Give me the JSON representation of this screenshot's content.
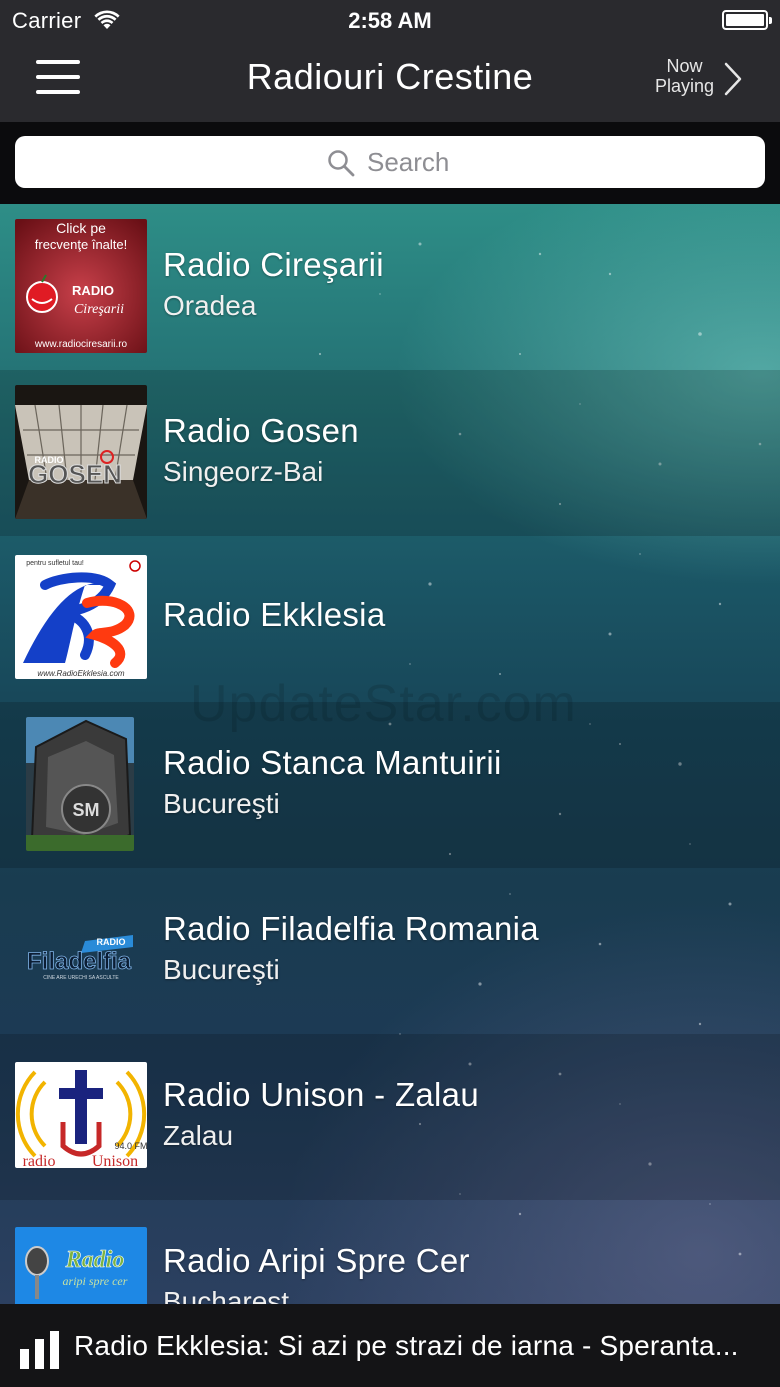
{
  "status_bar": {
    "carrier": "Carrier",
    "time": "2:58 AM"
  },
  "nav": {
    "title": "Radiouri Crestine",
    "now_playing_line1": "Now",
    "now_playing_line2": "Playing"
  },
  "search": {
    "placeholder": "Search"
  },
  "stations": [
    {
      "name": "Radio Cireşarii",
      "city": "Oradea",
      "logo_text": [
        "Click pe",
        "frecvenţe înalte!",
        "RADIO",
        "Cireşarii",
        "www.radiociresarii.ro"
      ]
    },
    {
      "name": "Radio Gosen",
      "city": "Singeorz-Bai",
      "logo_text": [
        "RADIO",
        "GOSEN"
      ]
    },
    {
      "name": "Radio Ekklesia",
      "city": "",
      "logo_text": [
        "pentru sufletul tau!",
        "www.RadioEkklesia.com"
      ]
    },
    {
      "name": "Radio Stanca Mantuirii",
      "city": "Bucureşti",
      "logo_text": [
        "SM"
      ]
    },
    {
      "name": "Radio Filadelfia Romania",
      "city": "Bucureşti",
      "logo_text": [
        "RADIO",
        "Filadelfia",
        "CINE ARE URECHI SA ASCULTE"
      ]
    },
    {
      "name": "Radio Unison - Zalau",
      "city": "Zalau",
      "logo_text": [
        "94.0 FM",
        "radio",
        "Unison"
      ]
    },
    {
      "name": "Radio Aripi Spre Cer",
      "city": "Bucharest",
      "logo_text": [
        "Radio",
        "aripi spre cer"
      ]
    }
  ],
  "watermark": "UpdateStar.com",
  "player": {
    "now_playing": "Radio Ekklesia: Si azi pe strazi de iarna - Speranta..."
  },
  "colors": {
    "nav_bg": "#2a2a2e",
    "search_bg": "#0b0b0d",
    "player_bg": "#141416",
    "list_top": "#2e8e87",
    "list_bottom": "#2c4060"
  }
}
